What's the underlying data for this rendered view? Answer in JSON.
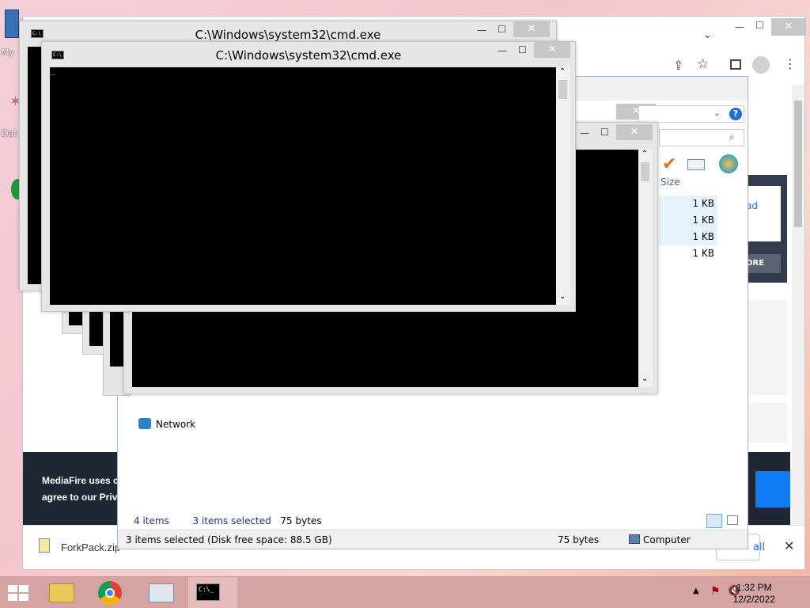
{
  "desktop": {
    "icon_labels": [
      "My",
      "Dat"
    ]
  },
  "browser": {
    "mediafire_notice": [
      "MediaFire uses c",
      "agree to our Priv"
    ],
    "panel_link": "ad",
    "panel_more": "ORE",
    "download_file": "ForkPack.zip",
    "show_all": "all",
    "close": "✕"
  },
  "explorer": {
    "size_header": "Size",
    "sizes": [
      "1 KB",
      "1 KB",
      "1 KB",
      "1 KB"
    ],
    "network_label": "Network",
    "info_items": "4 items",
    "info_selected": "3 items selected",
    "info_bytes": "75 bytes",
    "status_left": "3 items selected (Disk free space: 88.5 GB)",
    "status_size": "75 bytes",
    "status_location": "Computer"
  },
  "cmd": {
    "title_back": "C:\\Windows\\system32\\cmd.exe",
    "title_front": "C:\\Windows\\system32\\cmd.exe",
    "cursor": "_"
  },
  "window_buttons": {
    "minimize": "—",
    "maximize": "☐",
    "close": "✕"
  },
  "taskbar": {
    "time": "1:32 PM",
    "date": "12/2/2022"
  },
  "colors": {
    "taskbar": "#d6a3a3",
    "cookie_bg": "#1f2634",
    "accent_blue": "#0f7cf6",
    "console": "#000000"
  }
}
